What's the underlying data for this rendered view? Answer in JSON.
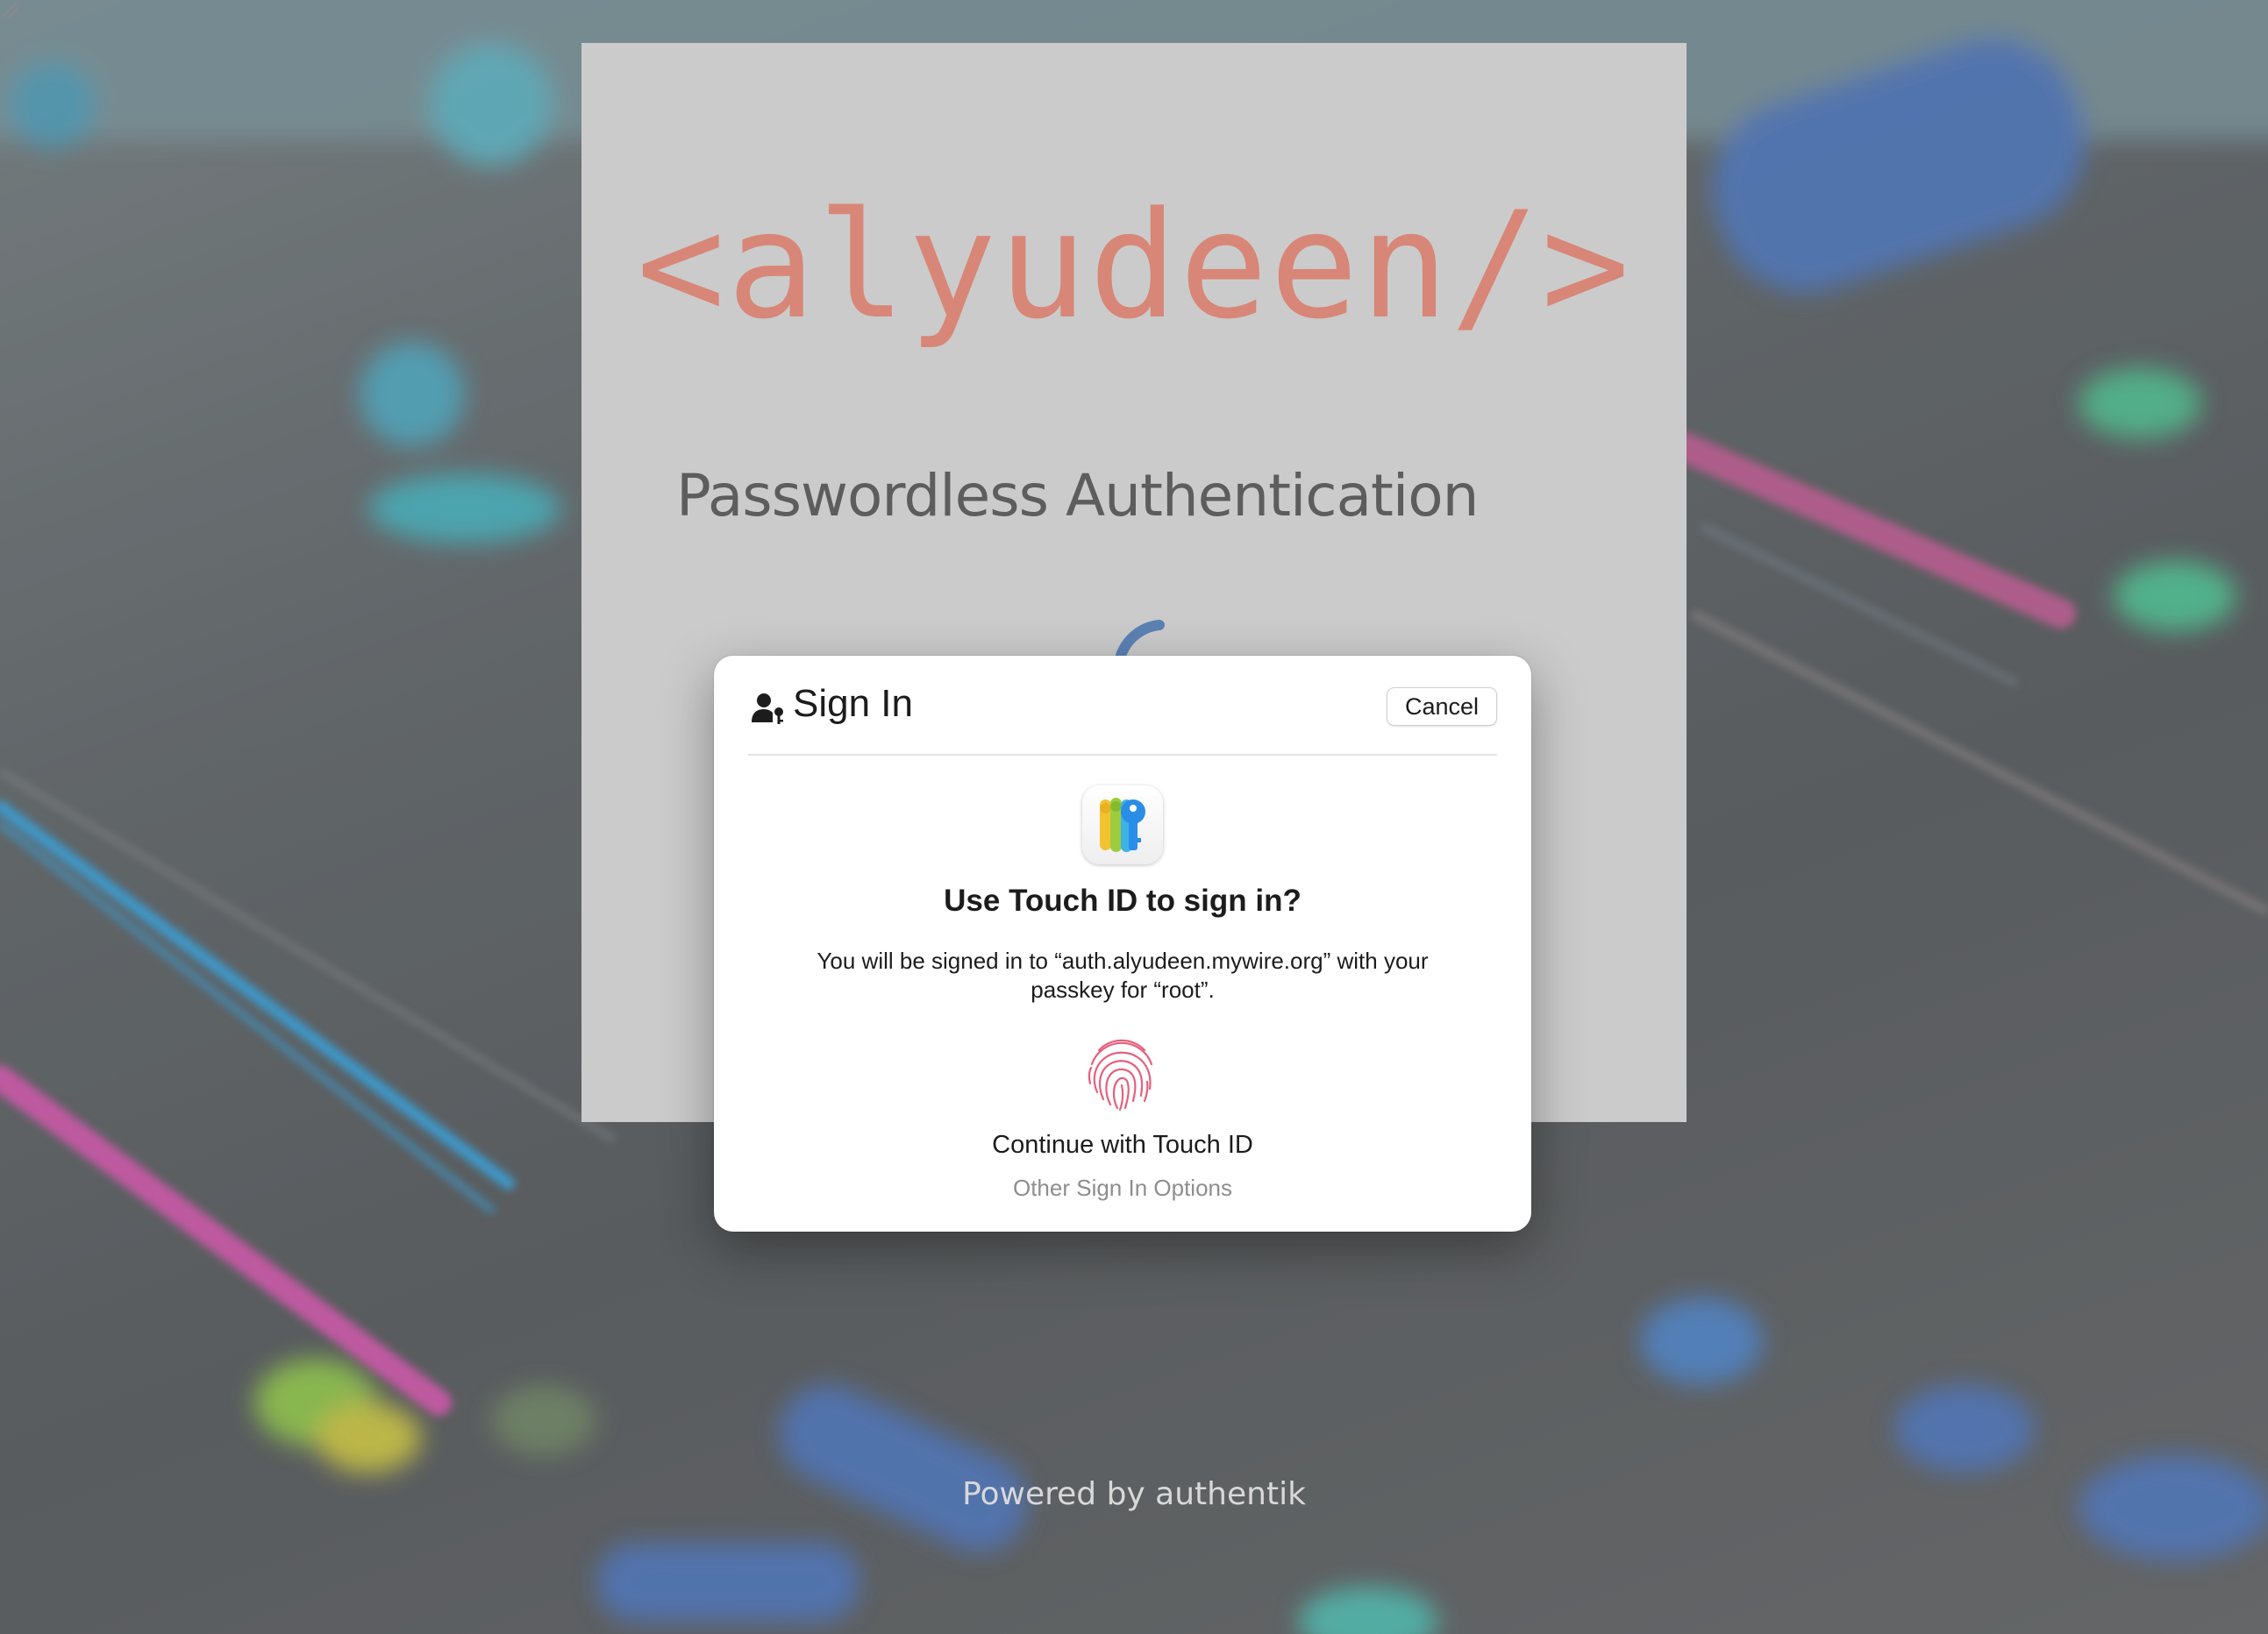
{
  "brand": {
    "logo_text": "<alyudeen/>"
  },
  "page": {
    "title": "Passwordless Authentication",
    "footer": "Powered by authentik"
  },
  "dialog": {
    "title": "Sign In",
    "cancel_label": "Cancel",
    "question": "Use Touch ID to sign in?",
    "description": "You will be signed in to “auth.alyudeen.mywire.org” with your passkey for “root”.",
    "continue_label": "Continue with Touch ID",
    "other_options_label": "Other Sign In Options",
    "app_icon": "passwords-keys-icon",
    "touch_icon": "fingerprint-icon",
    "header_icon": "person-key-icon"
  },
  "colors": {
    "brand": "#d88677",
    "card": "#cbcbcb",
    "spinner": "#5b82b4",
    "fingerprint": "#e5607d"
  }
}
